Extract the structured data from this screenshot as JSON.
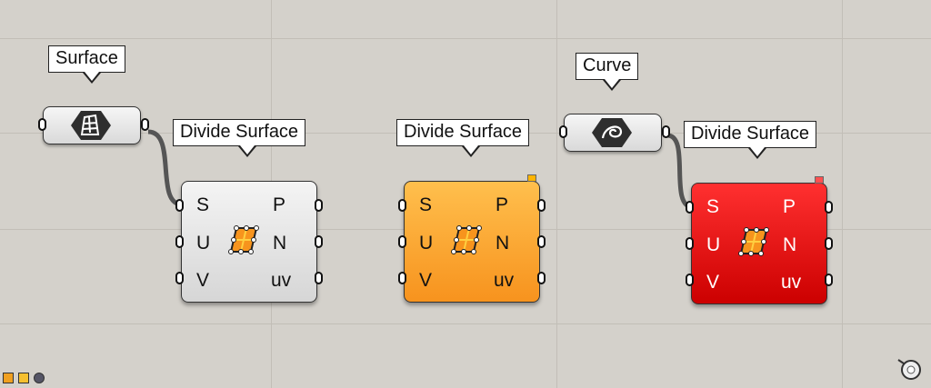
{
  "tooltips": {
    "surface_param": "Surface",
    "curve_param": "Curve",
    "divide_1": "Divide Surface",
    "divide_2": "Divide Surface",
    "divide_3": "Divide Surface"
  },
  "component": {
    "inputs": [
      "S",
      "U",
      "V"
    ],
    "outputs": [
      "P",
      "N",
      "uv"
    ]
  },
  "colors": {
    "canvas": "#d4d1cb",
    "normal_state": "#e8e8e8",
    "warning_state": "#f7931e",
    "error_state": "#cc0000",
    "wire": "#555555"
  },
  "icons": {
    "surface_param": "surface-param-icon",
    "curve_param": "curve-param-icon",
    "divide_surface": "divide-surface-icon",
    "toolbar": [
      "plugin-icon-1",
      "plugin-icon-2",
      "plugin-icon-3"
    ],
    "navigation": "navigation-widget-icon"
  }
}
